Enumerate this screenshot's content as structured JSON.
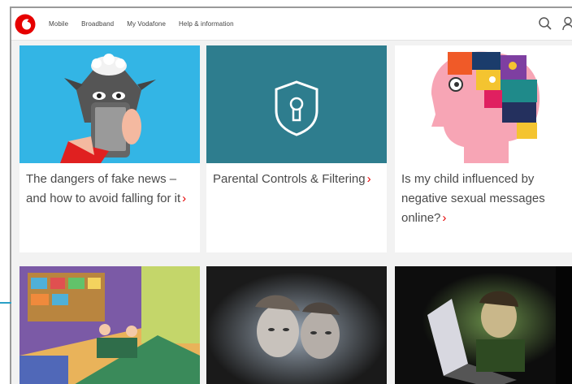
{
  "header": {
    "nav": [
      "Mobile",
      "Broadband",
      "My Vodafone",
      "Help & information"
    ],
    "icons": [
      "search-icon",
      "account-icon"
    ]
  },
  "colors": {
    "brand_red": "#e60000",
    "teal": "#2e7d8e",
    "sky": "#33b5e5"
  },
  "cards": [
    {
      "text": "The dangers of fake news – and how to avoid falling for it",
      "chevron": "›"
    },
    {
      "text": "Parental Controls & Filtering",
      "chevron": "›"
    },
    {
      "text": "Is my child influenced by negative sexual messages online?",
      "chevron": "›"
    }
  ]
}
